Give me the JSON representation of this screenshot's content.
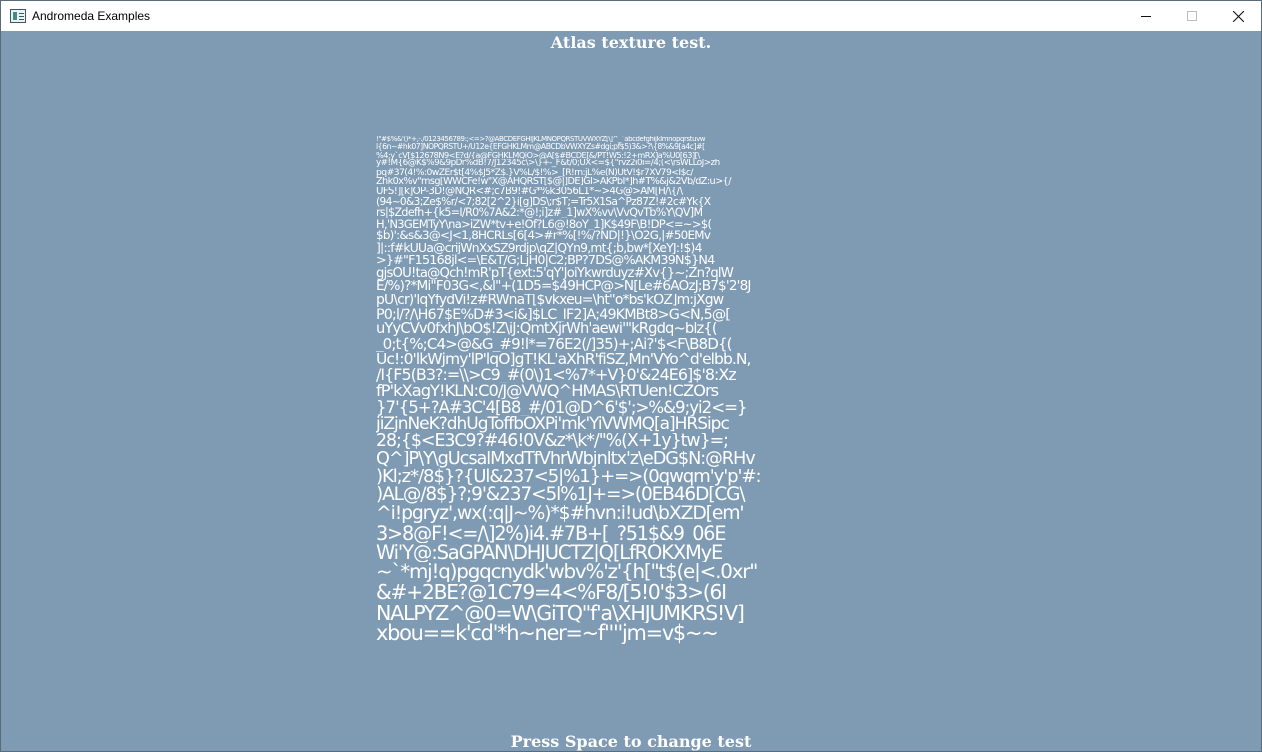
{
  "window": {
    "title": "Andromeda Examples",
    "icon": "app-window-icon",
    "controls": {
      "minimize_icon": "minimize-icon",
      "maximize_icon": "maximize-icon",
      "close_icon": "close-icon"
    }
  },
  "canvas": {
    "background": "#7f9bb4",
    "heading": "Atlas texture test.",
    "footer": "Press Space to change test"
  },
  "atlas": {
    "glyph_color": "#ffffff",
    "rows": [
      "!\"#$%&'()*+,-./0123456789:;<=>?@ABCDEFGHIJKLMNOPQRSTUVWXYZ[\\]^_`abcdefghijklmnopqrstuvw",
      "l{6n~#hk07]NOPQRSTU+/U12e{EFGHKLMm@ABCDbVWXYZs#dgi;pf$5)3&>?\\{8%&9[a4c]#[",
      "%4;y`cV[$12678N9<E?d/{a@FGHKLMQiO>@A[$#BCDE[&/PT!W5:!2+mRX]a%U0[63][\\",
      "y#!M{6@K$%9&9pDr%dB!7/J12345c\\>\\}+-_F&t/0;UX<=${\"rvz2i0i=/4;(<\\rsWLLoJ>zh",
      "pq#37(4!%:0wZEr$t[4%$J5*Z$.}V%L/$!%>_[R!rn:jL%e(N)UtV!$r7XV79<I$c/",
      "Zhk0x%v\"msg[WWCFe!w\"X@AHQRST[$@|]DE]GI>AKPbI*]h#T%&j&2Vb/dZ:u>{/",
      "UFS!][k]OP-3D!@NQR<#;c7B9!#G*%k3056L1*~>4G@>AM[H/\\{/\\",
      "(94~0&3;Ze$%r/<7;82[2^2}i[g]DS\\;r$T;=Tr5X1Sa^Pz87Z!#2c#Yk{X",
      "rs|$Zdefh+{k5=I/R0%7A&2:*@!;i]z#_1]wX%vv\\VvQvTb%Y\\QV]M",
      "H,'N3GEMTyY\\na>iZW*tv+e!Of?L6@!8oY_1]K$49F\\B!DP<=~>$(",
      "$b)':&s&3@<J<1,8HCRLs[6[4>#r*%[!%/?ND|!}\\O2G,|#50EMv",
      "]|::f#kUUa@crijWnXxSZ9rdjp\\qZ|QYn9,mt{;b,bw*[XeYJ:!$)4",
      ">}#\"F15168jl<=\\E&T/G;LjH0|C2;BP?7DS@%AKM39N$}N4",
      "gjsOU!ta@Qch!mR'pT{ext:5'qY'JoiYkwrduyz#Xv{}~;Zn?qlW",
      "E/%)?*Mi\"F03G<,&l\"+(1D5=$49HCP@>N[Le#6AOzJ;B7$'2'8J",
      "pU\\cr)'lqYfydVi!z#RWnaT[$vkxeu=\\ht''o*bs'kOZ]m:jXgw",
      "P0;l/?/\\H67$E%D#3<i&]$LC_IF2]A;49KMBt8>G<N,5@[",
      "uYyCVv0fxhJ\\bO$!Z\\iJ:QmtXjrWh'aewi'\"kRgdq~blz{(",
      "_0;t{%;C4>@&G_#9!l*=76E2(/]35)+;Ai?'$<F\\B8D{(",
      "Uc!:0'lkWjmy'lP'lqO]gT!KL'aXhR'fiSZ,Mn'VYo^d'elbb.N,",
      "/I{F5(B3?:=\\\\>C9_#(0\\)1<%7*+V}0'&24E6]$'8:Xz",
      "fP'kXagY!KLN:C0/J@VWQ^HMAS\\RTUen!CZOrs",
      "}7'{5+?A#3C'4[B8_#/01@D^6'$';>%&9;yi2<=}",
      "jiZjnNeK?dhUgToffbOXPi'mk'YiVWMQ[a]HRSipc",
      "28;{$<E3C9?#46!0V&z*\\k*/\"%(X+1y}tw}=;",
      "Q^]P\\Y\\gUcsalMxdTfVhrWbjnltx'z\\eDG$N:@RHv",
      ")Kl;z*/8$}?{Ul&237<5|%1}+=>(0qwqm'y'p'#:",
      ")AL@/8$}?;9'&237<5l%1J+=>(0EB46D[CG\\",
      "^i!pgryz',wx(:q|J~%)*$#hvn:i!ud\\bXZD[em'",
      "3>8@F!<=/\\]2%)i4.#7B+[_?51$&9_06E",
      "Wi'Y@:SaGPAN\\DHJUCTZ|Q[LfROKXMyE",
      "~`*mj!q)pgqcnydk'wbv%'z'{h[\"t$(e|<.0xr\"",
      "&#+2BE?@1C79=4<%F8/[5!0'$3>(6I",
      "NALPYZ^@0=W\\GiTQ\"f'a\\XHJUMKRS!V]",
      "xbou==k'cd'*h~ner=~f''''jm=v$~~"
    ]
  }
}
